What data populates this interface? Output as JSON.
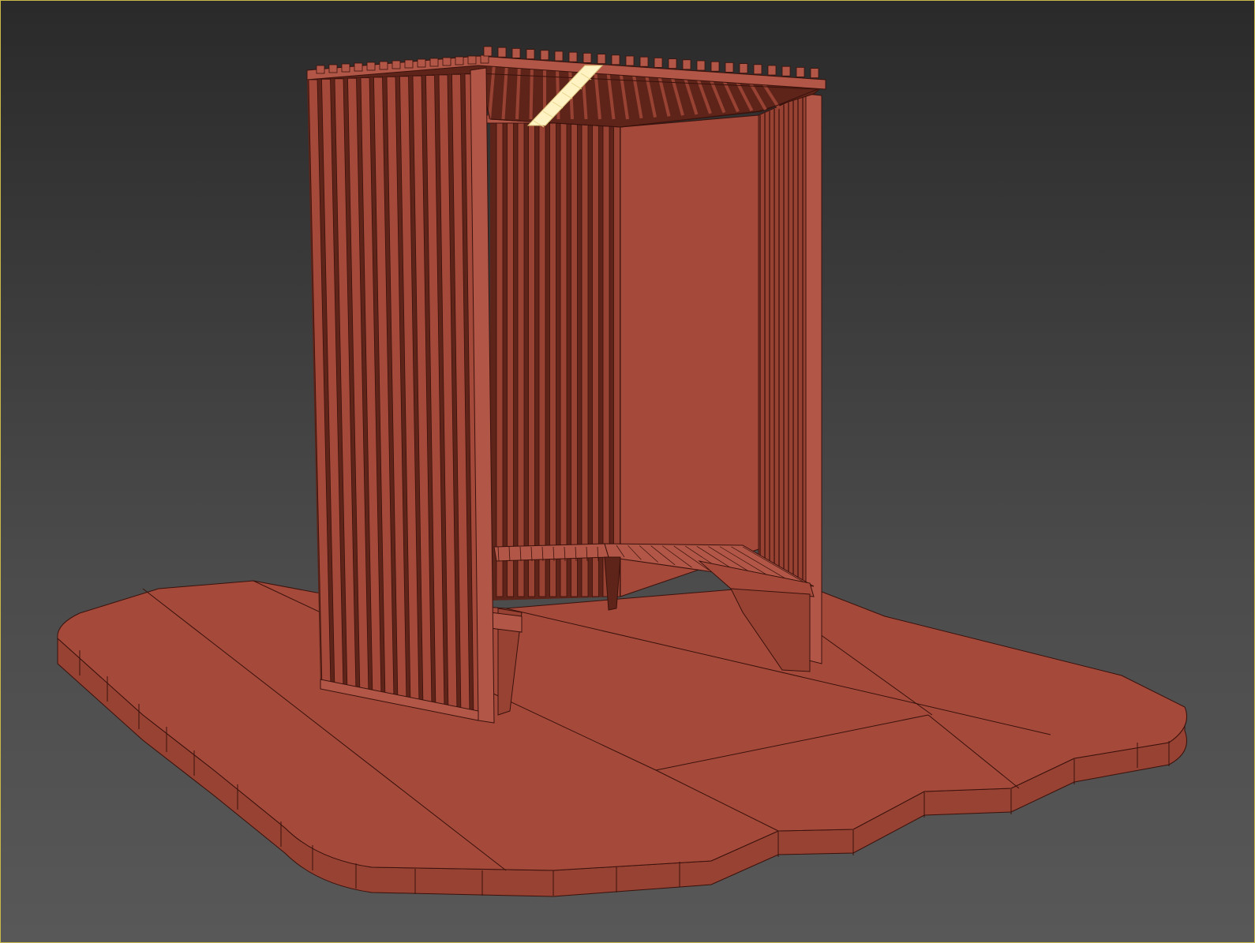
{
  "viewport": {
    "kind": "3d-viewport",
    "active": true
  },
  "colors": {
    "background_top": "#2a2a2a",
    "background_mid": "#4b4b4b",
    "background_bottom": "#585858",
    "viewport_border": "#c9b84a",
    "model_base": "#a54a3b",
    "model_light": "#b25747",
    "model_mid": "#984233",
    "model_dark": "#5e2419",
    "wireframe": "#3a120c",
    "light_fixture": "#fff3c4"
  },
  "scene": {
    "object": "slatted-shelter-pavilion",
    "parts": [
      "ground-slab",
      "rear-slat-wall",
      "front-slat-panel",
      "side-slat-panel",
      "back-solid-panel",
      "roof-slats",
      "bench",
      "ceiling-light"
    ]
  }
}
